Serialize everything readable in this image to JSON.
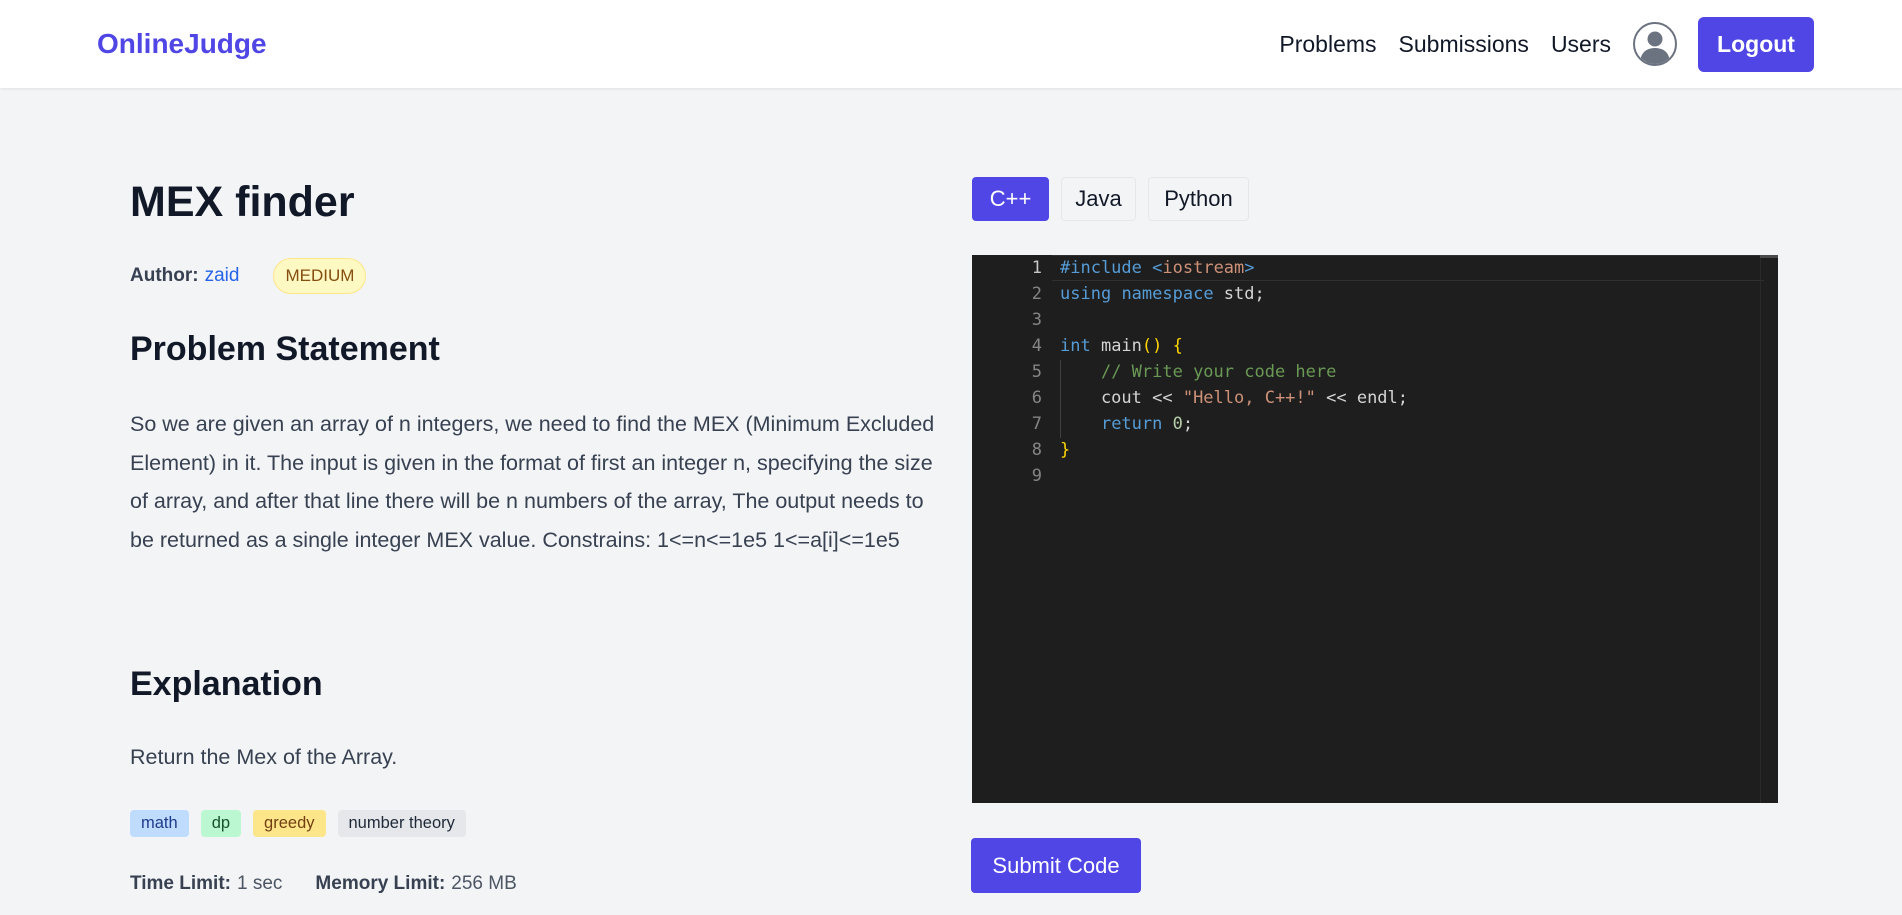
{
  "navbar": {
    "brand": "OnlineJudge",
    "links": [
      "Problems",
      "Submissions",
      "Users"
    ],
    "logout_label": "Logout"
  },
  "problem": {
    "title": "MEX finder",
    "author_label": "Author:",
    "author_name": "zaid",
    "difficulty": "MEDIUM",
    "statement_heading": "Problem Statement",
    "statement": "So we are given an array of n integers, we need to find the MEX (Minimum Excluded Element) in it. The input is given in the format of first an integer n, specifying the size of array, and after that line there will be n numbers of the array, The output needs to be returned as a single integer MEX value. Constrains: 1<=n<=1e5 1<=a[i]<=1e5",
    "explanation_heading": "Explanation",
    "explanation": "Return the Mex of the Array.",
    "tags": [
      "math",
      "dp",
      "greedy",
      "number theory"
    ],
    "time_limit_label": "Time Limit:",
    "time_limit_value": "1 sec",
    "memory_limit_label": "Memory Limit:",
    "memory_limit_value": "256 MB"
  },
  "editor": {
    "languages": [
      "C++",
      "Java",
      "Python"
    ],
    "active_language": "C++",
    "line_numbers": [
      "1",
      "2",
      "3",
      "4",
      "5",
      "6",
      "7",
      "8",
      "9"
    ],
    "code_lines": [
      "#include <iostream>",
      "using namespace std;",
      "",
      "int main() {",
      "    // Write your code here",
      "    cout << \"Hello, C++!\" << endl;",
      "    return 0;",
      "}",
      ""
    ]
  },
  "submit_label": "Submit Code",
  "colors": {
    "accent": "#4f46e5",
    "editor_bg": "#1e1e1e",
    "medium_badge_bg": "#fef9c3"
  }
}
